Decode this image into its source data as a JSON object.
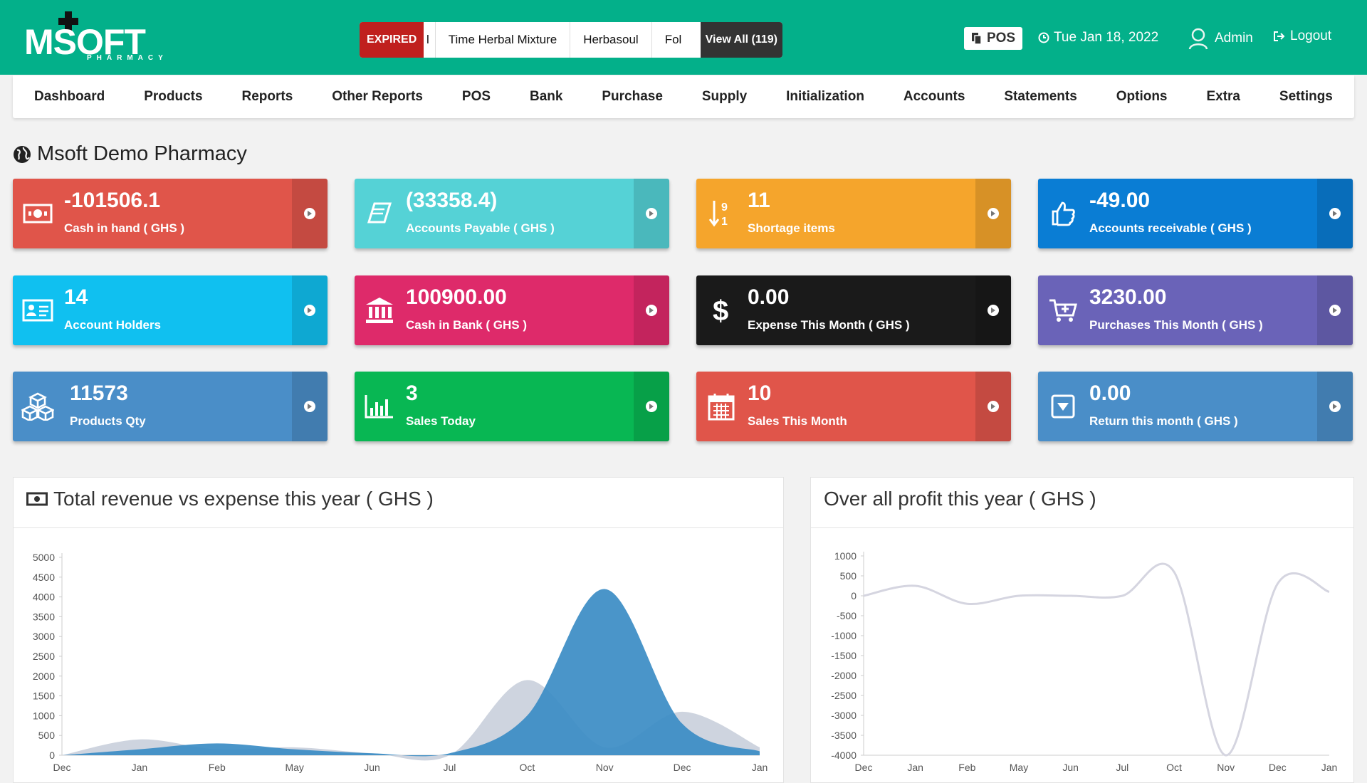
{
  "topbar": {
    "logo_text": "MSOFT",
    "logo_sub": "PHARMACY",
    "ticker": {
      "badge": "EXPIRED",
      "items": [
        "l",
        "Time Herbal Mixture",
        "Herbasoul",
        "Fol"
      ],
      "view_all": "View All (119)"
    },
    "pos_label": "POS",
    "date": "Tue Jan 18, 2022",
    "user": "Admin",
    "logout": "Logout"
  },
  "nav": {
    "items": [
      "Dashboard",
      "Products",
      "Reports",
      "Other Reports",
      "POS",
      "Bank",
      "Purchase",
      "Supply",
      "Initialization",
      "Accounts",
      "Statements",
      "Options",
      "Extra",
      "Settings"
    ]
  },
  "page": {
    "title": "Msoft Demo Pharmacy"
  },
  "cards": [
    {
      "value": "-101506.1",
      "label": "Cash in hand ( GHS )",
      "icon": "money-icon",
      "color": "#e0554a"
    },
    {
      "value": "(33358.4)",
      "label": "Accounts Payable ( GHS )",
      "icon": "book-icon",
      "color": "#55d2d6"
    },
    {
      "value": "11",
      "label": "Shortage items",
      "icon": "sort-numeric-icon",
      "color": "#f5a52c"
    },
    {
      "value": "-49.00",
      "label": "Accounts receivable ( GHS )",
      "icon": "thumbs-up-icon",
      "color": "#0a7dd4"
    },
    {
      "value": "14",
      "label": "Account Holders",
      "icon": "id-card-icon",
      "color": "#10c0f0"
    },
    {
      "value": "100900.00",
      "label": "Cash in Bank ( GHS )",
      "icon": "bank-icon",
      "color": "#de2a6a"
    },
    {
      "value": "0.00",
      "label": "Expense This Month ( GHS )",
      "icon": "dollar-icon",
      "color": "#1a1a1a"
    },
    {
      "value": "3230.00",
      "label": "Purchases This Month ( GHS )",
      "icon": "cart-icon",
      "color": "#6a63b8"
    },
    {
      "value": "11573",
      "label": "Products Qty",
      "icon": "cubes-icon",
      "color": "#4a8ec8"
    },
    {
      "value": "3",
      "label": "Sales Today",
      "icon": "bar-chart-icon",
      "color": "#08b753"
    },
    {
      "value": "10",
      "label": "Sales This Month",
      "icon": "calendar-icon",
      "color": "#e0554a"
    },
    {
      "value": "0.00",
      "label": "Return this month ( GHS )",
      "icon": "caret-square-icon",
      "color": "#4a8ec8"
    }
  ],
  "chart_data": [
    {
      "type": "area",
      "title": "Total revenue vs expense this year ( GHS )",
      "categories": [
        "Dec",
        "Jan",
        "Feb",
        "May",
        "Jun",
        "Jul",
        "Oct",
        "Nov",
        "Dec",
        "Jan"
      ],
      "ylim": [
        0,
        5000
      ],
      "yticks": [
        0,
        500,
        1000,
        1500,
        2000,
        2500,
        3000,
        3500,
        4000,
        4500,
        5000
      ],
      "grid": false,
      "series": [
        {
          "values": [
            0,
            400,
            150,
            200,
            50,
            0,
            1900,
            200,
            1100,
            200
          ],
          "color": "#c9cfdb"
        },
        {
          "values": [
            0,
            150,
            300,
            150,
            50,
            50,
            1000,
            4200,
            800,
            100
          ],
          "color": "#3b8cc4"
        }
      ]
    },
    {
      "type": "line",
      "title": "Over all profit this year ( GHS )",
      "categories": [
        "Dec",
        "Jan",
        "Feb",
        "May",
        "Jun",
        "Jul",
        "Oct",
        "Nov",
        "Dec",
        "Jan"
      ],
      "ylim": [
        -4000,
        1000
      ],
      "yticks": [
        1000,
        500,
        0,
        -500,
        -1000,
        -1500,
        -2000,
        -2500,
        -3000,
        -3500,
        -4000
      ],
      "grid": false,
      "series": [
        {
          "values": [
            0,
            250,
            -200,
            0,
            0,
            0,
            600,
            -4000,
            300,
            100
          ],
          "color": "#d5d5e0"
        }
      ]
    }
  ]
}
